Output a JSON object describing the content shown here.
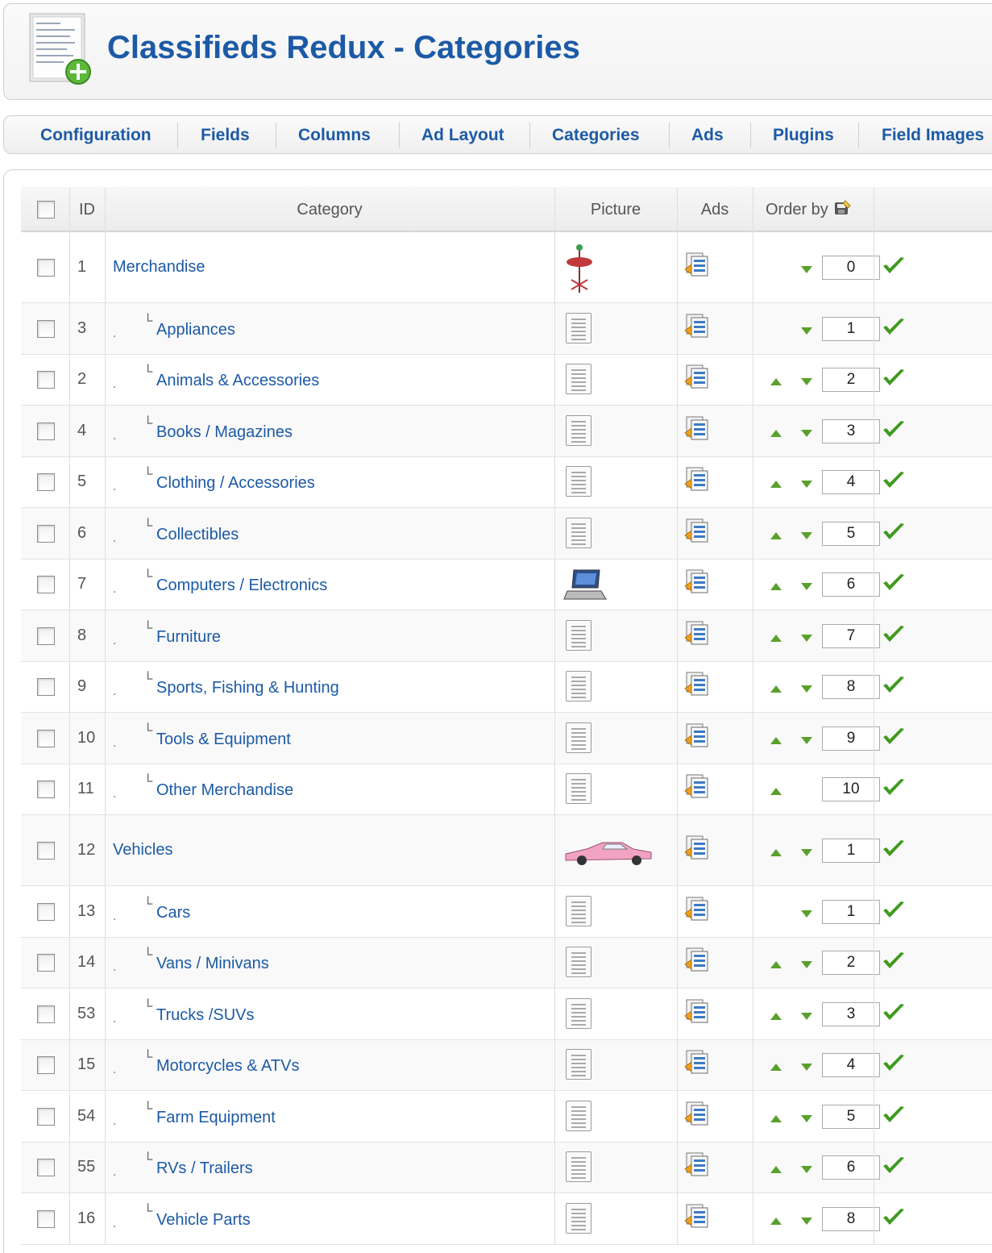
{
  "page": {
    "title": "Classifieds Redux - Categories"
  },
  "toolbar": {
    "tabs": [
      "Configuration",
      "Fields",
      "Columns",
      "Ad Layout",
      "Categories",
      "Ads",
      "Plugins",
      "Field Images"
    ]
  },
  "table": {
    "headers": {
      "id": "ID",
      "category": "Category",
      "picture": "Picture",
      "ads": "Ads",
      "order_by": "Order by"
    },
    "rows": [
      {
        "id": "1",
        "label": "Merchandise",
        "level": 0,
        "picture": "flower-thumbnail",
        "order": "0",
        "up": false,
        "down": true
      },
      {
        "id": "3",
        "label": "Appliances",
        "level": 1,
        "picture": "document-icon",
        "order": "1",
        "up": false,
        "down": true
      },
      {
        "id": "2",
        "label": "Animals & Accessories",
        "level": 1,
        "picture": "document-icon",
        "order": "2",
        "up": true,
        "down": true
      },
      {
        "id": "4",
        "label": "Books / Magazines",
        "level": 1,
        "picture": "document-icon",
        "order": "3",
        "up": true,
        "down": true
      },
      {
        "id": "5",
        "label": "Clothing / Accessories",
        "level": 1,
        "picture": "document-icon",
        "order": "4",
        "up": true,
        "down": true
      },
      {
        "id": "6",
        "label": "Collectibles",
        "level": 1,
        "picture": "document-icon",
        "order": "5",
        "up": true,
        "down": true
      },
      {
        "id": "7",
        "label": "Computers / Electronics",
        "level": 1,
        "picture": "laptop-thumbnail",
        "order": "6",
        "up": true,
        "down": true
      },
      {
        "id": "8",
        "label": "Furniture",
        "level": 1,
        "picture": "document-icon",
        "order": "7",
        "up": true,
        "down": true
      },
      {
        "id": "9",
        "label": "Sports, Fishing & Hunting",
        "level": 1,
        "picture": "document-icon",
        "order": "8",
        "up": true,
        "down": true
      },
      {
        "id": "10",
        "label": "Tools & Equipment",
        "level": 1,
        "picture": "document-icon",
        "order": "9",
        "up": true,
        "down": true
      },
      {
        "id": "11",
        "label": "Other Merchandise",
        "level": 1,
        "picture": "document-icon",
        "order": "10",
        "up": true,
        "down": false
      },
      {
        "id": "12",
        "label": "Vehicles",
        "level": 0,
        "picture": "car-thumbnail",
        "order": "1",
        "up": true,
        "down": true
      },
      {
        "id": "13",
        "label": "Cars",
        "level": 1,
        "picture": "document-icon",
        "order": "1",
        "up": false,
        "down": true
      },
      {
        "id": "14",
        "label": "Vans / Minivans",
        "level": 1,
        "picture": "document-icon",
        "order": "2",
        "up": true,
        "down": true
      },
      {
        "id": "53",
        "label": "Trucks /SUVs",
        "level": 1,
        "picture": "document-icon",
        "order": "3",
        "up": true,
        "down": true
      },
      {
        "id": "15",
        "label": "Motorcycles & ATVs",
        "level": 1,
        "picture": "document-icon",
        "order": "4",
        "up": true,
        "down": true
      },
      {
        "id": "54",
        "label": "Farm Equipment",
        "level": 1,
        "picture": "document-icon",
        "order": "5",
        "up": true,
        "down": true
      },
      {
        "id": "55",
        "label": "RVs / Trailers",
        "level": 1,
        "picture": "document-icon",
        "order": "6",
        "up": true,
        "down": true
      },
      {
        "id": "16",
        "label": "Vehicle Parts",
        "level": 1,
        "picture": "document-icon",
        "order": "8",
        "up": true,
        "down": true
      }
    ]
  },
  "colors": {
    "link": "#1c5aa6",
    "arrow": "#5aa02c",
    "check": "#3f9a1e"
  }
}
